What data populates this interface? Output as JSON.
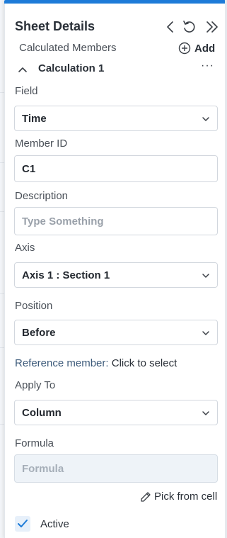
{
  "panel": {
    "title": "Sheet Details",
    "icons": [
      "chevron-left-icon",
      "undo-icon",
      "double-chevron-right-icon"
    ],
    "accent_color": "#1d7bd8"
  },
  "calculated_members": {
    "label": "Calculated Members",
    "add_label": "Add"
  },
  "calculation": {
    "title": "Calculation 1",
    "more": "···"
  },
  "fields": {
    "field": {
      "label": "Field",
      "value": "Time"
    },
    "member_id": {
      "label": "Member ID",
      "value": "C1"
    },
    "description": {
      "label": "Description",
      "placeholder": "Type Something"
    },
    "axis": {
      "label": "Axis",
      "value": "Axis 1 : Section 1"
    },
    "position": {
      "label": "Position",
      "value": "Before"
    },
    "reference_member": {
      "label": "Reference member:",
      "value": "Click to select"
    },
    "apply_to": {
      "label": "Apply To",
      "value": "Column"
    },
    "formula": {
      "label": "Formula",
      "placeholder": "Formula"
    }
  },
  "pick_from_cell": "Pick from cell",
  "active": {
    "label": "Active",
    "checked": true
  }
}
